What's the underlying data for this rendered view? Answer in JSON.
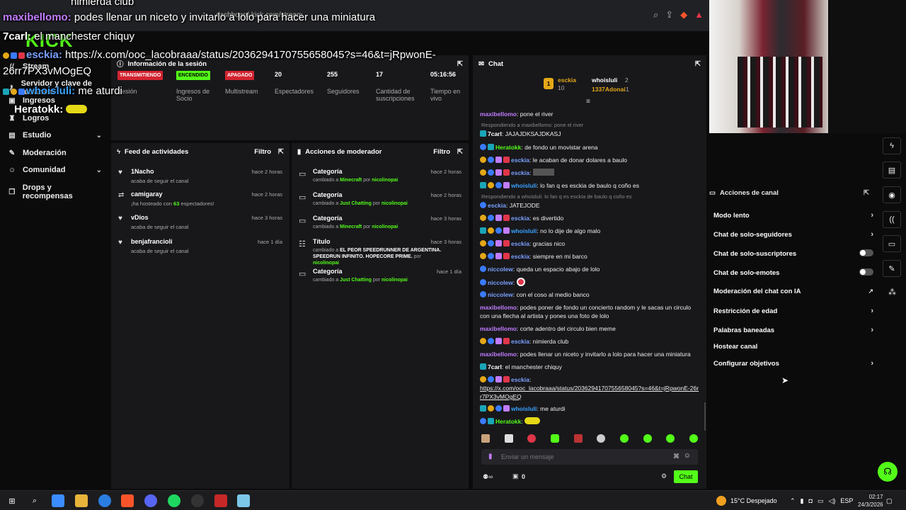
{
  "browser": {
    "url": "dashboard.kick.com/stream"
  },
  "logo": "KICK",
  "overlay": [
    {
      "user": "",
      "text": "nimierda club",
      "color": "#ffffff"
    },
    {
      "user": "maxibellomo:",
      "text": "podes llenar un niceto y invitarlo a lolo para hacer una miniatura",
      "color": "#c17cff"
    },
    {
      "user": "7carl:",
      "text": "el manchester chiquy",
      "color": "#ffffff"
    },
    {
      "user": "esckia:",
      "text": "https://x.com/ooc_lacobraaa/status/2036294170755658045?s=46&t=jRpwonE-",
      "color": "#7aa0ff"
    },
    {
      "user": "",
      "text": "26rr7PX3vMOgEQ",
      "color": "#ffffff"
    },
    {
      "user": "whoisluli:",
      "text": "me aturdi",
      "color": "#3aa0ff"
    },
    {
      "user": "Heratokk:",
      "text": "",
      "color": "#ffffff"
    }
  ],
  "sidebar": {
    "items": [
      {
        "label": "Stream",
        "icon": "broadcast-icon"
      },
      {
        "label": "Servidor y clave de retransm",
        "icon": "key-icon"
      },
      {
        "label": "Ingresos",
        "icon": "money-icon"
      },
      {
        "label": "Logros",
        "icon": "trophy-icon"
      },
      {
        "label": "Estudio",
        "icon": "studio-icon",
        "chevron": true
      },
      {
        "label": "Moderación",
        "icon": "wrench-icon"
      },
      {
        "label": "Comunidad",
        "icon": "community-icon",
        "chevron": true
      },
      {
        "label": "Drops y recompensas",
        "icon": "gift-icon"
      }
    ]
  },
  "session": {
    "title": "Información de la sesión",
    "stats": [
      {
        "value": "TRANSMITIENDO",
        "label": "Sesión",
        "badge": "#d3232f"
      },
      {
        "value": "ENCENDIDO",
        "label": "Ingresos de Socio",
        "badge": "#53fc18"
      },
      {
        "value": "APAGADO",
        "label": "Multistream",
        "badge": "#d3232f"
      },
      {
        "value": "20",
        "label": "Espectadores"
      },
      {
        "value": "255",
        "label": "Seguidores"
      },
      {
        "value": "17",
        "label": "Cantidad de suscripciones"
      },
      {
        "value": "05:16:56",
        "label": "Tiempo en vivo"
      }
    ]
  },
  "feed": {
    "title": "Feed de actividades",
    "filter": "Filtro",
    "rows": [
      {
        "name": "1Nacho",
        "sub": "acaba de seguir el canal",
        "time": "hace 2 horas",
        "icon": "heart-icon"
      },
      {
        "name": "camigaray",
        "sub_pre": "¡ha hosteado con ",
        "sub_num": "63",
        "sub_post": " espectadores!",
        "time": "hace 2 horas",
        "icon": "host-icon"
      },
      {
        "name": "vDios",
        "sub": "acaba de seguir el canal",
        "time": "hace 3 horas",
        "icon": "heart-icon"
      },
      {
        "name": "benjafrancioli",
        "sub": "acaba de seguir el canal",
        "time": "hace 1 día",
        "icon": "heart-icon"
      }
    ]
  },
  "modactions": {
    "title": "Acciones de moderador",
    "filter": "Filtro",
    "rows": [
      {
        "name": "Categoría",
        "sub_pre": "cambiado a ",
        "value": "Minecraft",
        "by": " por ",
        "mod": "nicolinopai",
        "time": "hace 2 horas"
      },
      {
        "name": "Categoría",
        "sub_pre": "cambiado a ",
        "value": "Just Chatting",
        "by": " por ",
        "mod": "nicolinopai",
        "time": "hace 2 horas"
      },
      {
        "name": "Categoría",
        "sub_pre": "cambiado a ",
        "value": "Minecraft",
        "by": " por ",
        "mod": "nicolinopai",
        "time": "hace 3 horas"
      },
      {
        "name": "Título",
        "sub_pre": "cambiado a ",
        "value": "EL PEOR SPEEDRUNNER DE ARGENTINA. SPEEDRUN INFINITO. HOPECORE PRIME.",
        "by": " por ",
        "mod": "nicolinopai",
        "time": "hace 3 horas"
      },
      {
        "name": "Categoría",
        "sub_pre": "cambiado a ",
        "value": "Just Chatting",
        "by": " por ",
        "mod": "nicolinopai",
        "time": "hace 1 día"
      }
    ]
  },
  "chat": {
    "title": "Chat",
    "top": [
      {
        "rank": "1",
        "name": "esckia",
        "sub": "10"
      },
      {
        "rank": "",
        "name": "whoisluli",
        "sub": "2"
      },
      {
        "rank": "",
        "name": "1337Adonai",
        "sub": "1"
      }
    ],
    "messages": [
      {
        "type": "msg",
        "user": "maxibellomo",
        "color": "#c17cff",
        "text": "pone el river"
      },
      {
        "type": "reply",
        "text": "Respondiendo a maxibellomo: pone el river"
      },
      {
        "type": "msg",
        "user": "7carl",
        "color": "#ffffff",
        "text": "JAJAJDKSAJDKASJ"
      },
      {
        "type": "msg",
        "user": "Heratokk",
        "color": "#53fc18",
        "text": "de fondo un movistar arena"
      },
      {
        "type": "msg",
        "user": "esckia",
        "color": "#7aa0ff",
        "text": "le acaban de donar             dolares a baulo"
      },
      {
        "type": "msg",
        "user": "esckia",
        "color": "#7aa0ff",
        "text": ""
      },
      {
        "type": "msg",
        "user": "whoisluli",
        "color": "#3aa0ff",
        "text": "lo fan q es esckia de baulo q coño es"
      },
      {
        "type": "reply",
        "text": "Respondiendo a whoisluli: lo fan q es esckia de baulo q coño es"
      },
      {
        "type": "msg",
        "user": "esckia",
        "color": "#7aa0ff",
        "text": "JATEJODE"
      },
      {
        "type": "msg",
        "user": "esckia",
        "color": "#7aa0ff",
        "text": "es divertido"
      },
      {
        "type": "msg",
        "user": "whoisluli",
        "color": "#3aa0ff",
        "text": "no lo dije de algo malo"
      },
      {
        "type": "msg",
        "user": "esckia",
        "color": "#7aa0ff",
        "text": "gracias nico"
      },
      {
        "type": "msg",
        "user": "esckia",
        "color": "#7aa0ff",
        "text": "siempre en mi barco"
      },
      {
        "type": "msg",
        "user": "niccolew",
        "color": "#7aa0ff",
        "text": "queda un espacio abajo de lolo"
      },
      {
        "type": "msg",
        "user": "niccolew",
        "color": "#7aa0ff",
        "text": ""
      },
      {
        "type": "msg",
        "user": "niccolew",
        "color": "#7aa0ff",
        "text": "con el coso al medio banco"
      },
      {
        "type": "msg",
        "user": "maxibellomo",
        "color": "#c17cff",
        "text": "podes poner de fondo un concierto random y le sacas un circulo con una flecha al artista y pones una foto de lolo"
      },
      {
        "type": "msg",
        "user": "maxibellomo",
        "color": "#c17cff",
        "text": "corte adentro del circulo bien meme"
      },
      {
        "type": "msg",
        "user": "esckia",
        "color": "#7aa0ff",
        "text": "nimierda club"
      },
      {
        "type": "msg",
        "user": "maxibellomo",
        "color": "#c17cff",
        "text": "podes llenar un niceto y invitarlo a lolo para hacer una miniatura"
      },
      {
        "type": "msg",
        "user": "7carl",
        "color": "#ffffff",
        "text": "el manchester chiquy"
      },
      {
        "type": "msg",
        "user": "esckia",
        "color": "#7aa0ff",
        "text": "https://x.com/ooc_lacobraaa/status/2036294170755658045?s=46&t=jRpwonE-26rr7PX3vMOgEQ"
      },
      {
        "type": "msg",
        "user": "whoisluli",
        "color": "#3aa0ff",
        "text": "me aturdi"
      },
      {
        "type": "msg",
        "user": "Heratokk",
        "color": "#53fc18",
        "text": ""
      }
    ],
    "input_placeholder": "Enviar un mensaje",
    "points": "0",
    "send_label": "Chat"
  },
  "canal": {
    "title": "Acciones de canal",
    "rows": [
      {
        "label": "Modo lento",
        "control": "chevron"
      },
      {
        "label": "Chat de solo-seguidores",
        "control": "chevron"
      },
      {
        "label": "Chat de solo-suscriptores",
        "control": "toggle"
      },
      {
        "label": "Chat de solo-emotes",
        "control": "toggle"
      },
      {
        "label": "Moderación del chat con IA",
        "control": "external"
      },
      {
        "label": "Restricción de edad",
        "control": "chevron"
      },
      {
        "label": "Palabras baneadas",
        "control": "chevron"
      },
      {
        "label": "Hostear canal",
        "control": "none"
      },
      {
        "label": "Configurar objetivos",
        "control": "chevron"
      }
    ]
  },
  "taskbar": {
    "weather_temp": "15°C",
    "weather_text": "Despejado",
    "lang": "ESP",
    "time": "02:17",
    "date": "24/3/2026"
  },
  "colors": {
    "accent": "#53fc18",
    "panel": "#18181b",
    "bg": "#0b0b0c",
    "red": "#d3232f"
  }
}
